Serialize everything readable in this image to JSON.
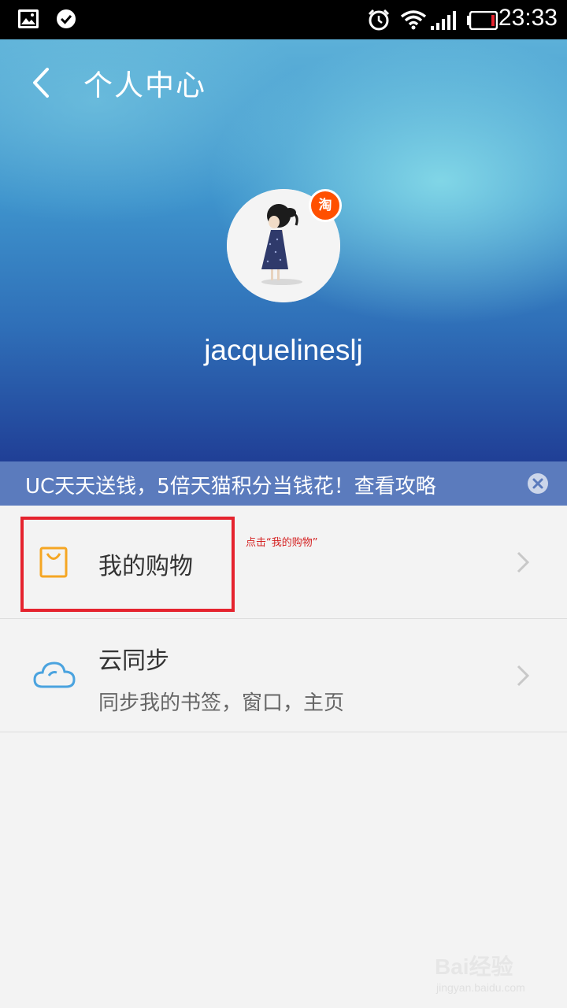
{
  "status_bar": {
    "time": "23:33",
    "icons": [
      "image-icon",
      "check-circle-icon",
      "alarm-icon",
      "wifi-icon",
      "signal-icon",
      "battery-icon"
    ]
  },
  "header": {
    "title": "个人中心",
    "username": "jacquelineslj",
    "badge": "淘"
  },
  "promo": {
    "text": "UC天天送钱，5倍天猫积分当钱花！查看攻略"
  },
  "menu": {
    "shopping": {
      "label": "我的购物",
      "icon": "shopping-bag-icon"
    },
    "sync": {
      "label": "云同步",
      "subtitle": "同步我的书签，窗口，主页",
      "icon": "cloud-icon"
    }
  },
  "annotation": "点击“我的购物”",
  "watermark": {
    "main": "Bai经验",
    "sub": "jingyan.baidu.com"
  },
  "colors": {
    "accent_orange": "#f5a623",
    "cloud_blue": "#4aa3df",
    "highlight_red": "#e5232e",
    "promo_bg": "#5b7bbd"
  }
}
